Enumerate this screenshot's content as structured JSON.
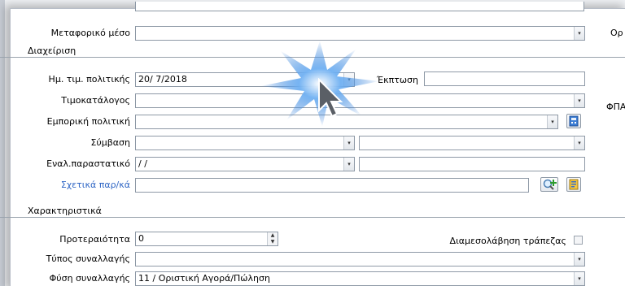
{
  "rows": {
    "transport": {
      "label": "Μεταφορικό μέσο",
      "value": ""
    },
    "policy_date": {
      "label": "Ημ. τιμ. πολιτικής",
      "value": "20/  7/2018"
    },
    "discount": {
      "label": "Έκπτωση",
      "value": ""
    },
    "price_list": {
      "label": "Τιμοκατάλογος",
      "value": ""
    },
    "commercial_policy": {
      "label": "Εμπορική πολιτική",
      "value": ""
    },
    "contract": {
      "label": "Σύμβαση",
      "value": "",
      "value2": ""
    },
    "alt_document": {
      "label": "Εναλ.παραστατικό",
      "value": "  /   /",
      "value2": ""
    },
    "related_docs": {
      "label": "Σχετικά παρ/κά",
      "value": ""
    },
    "priority": {
      "label": "Προτεραιότητα",
      "value": "0"
    },
    "bank_mediation": {
      "label": "Διαμεσολάβηση τράπεζας",
      "checked": false
    },
    "transaction_type": {
      "label": "Τύπος συναλλαγής",
      "value": ""
    },
    "transaction_nature": {
      "label": "Φύση συναλλαγής",
      "value": "11 / Οριστική Αγορά/Πώληση"
    }
  },
  "sections": {
    "management": "Διαχείριση",
    "characteristics": "Χαρακτηριστικά"
  },
  "right_cut_labels": {
    "top": "Ορ",
    "vat": "ΦΠΑ"
  },
  "icons": {
    "dropdown": "▾",
    "spin_up": "▲",
    "spin_down": "▼"
  },
  "colors": {
    "link": "#2f66c5",
    "border": "#8e99a6",
    "click_burst": "#3b8be0"
  }
}
